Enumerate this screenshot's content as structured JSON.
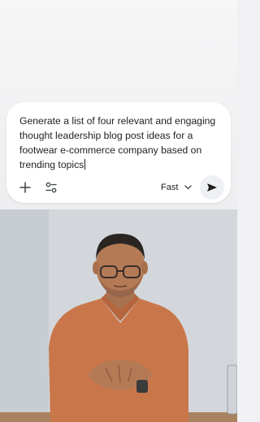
{
  "prompt": {
    "text": "Generate a list of four relevant and engaging\nthought leadership blog post ideas for a\nfootwear e-commerce company based on\ntrending topics"
  },
  "toolbar": {
    "add_icon": "plus-icon",
    "tools_icon": "tune-icon",
    "model_label": "Fast",
    "model_icon": "chevron-down-icon",
    "send_icon": "send-icon"
  },
  "video": {
    "description_icon": "presenter-video"
  },
  "colors": {
    "card": "#ffffff",
    "background": "#f1f1f3",
    "send_button": "#eef0f3",
    "shirt": "#c9774a",
    "wall": "#d3d7db"
  }
}
